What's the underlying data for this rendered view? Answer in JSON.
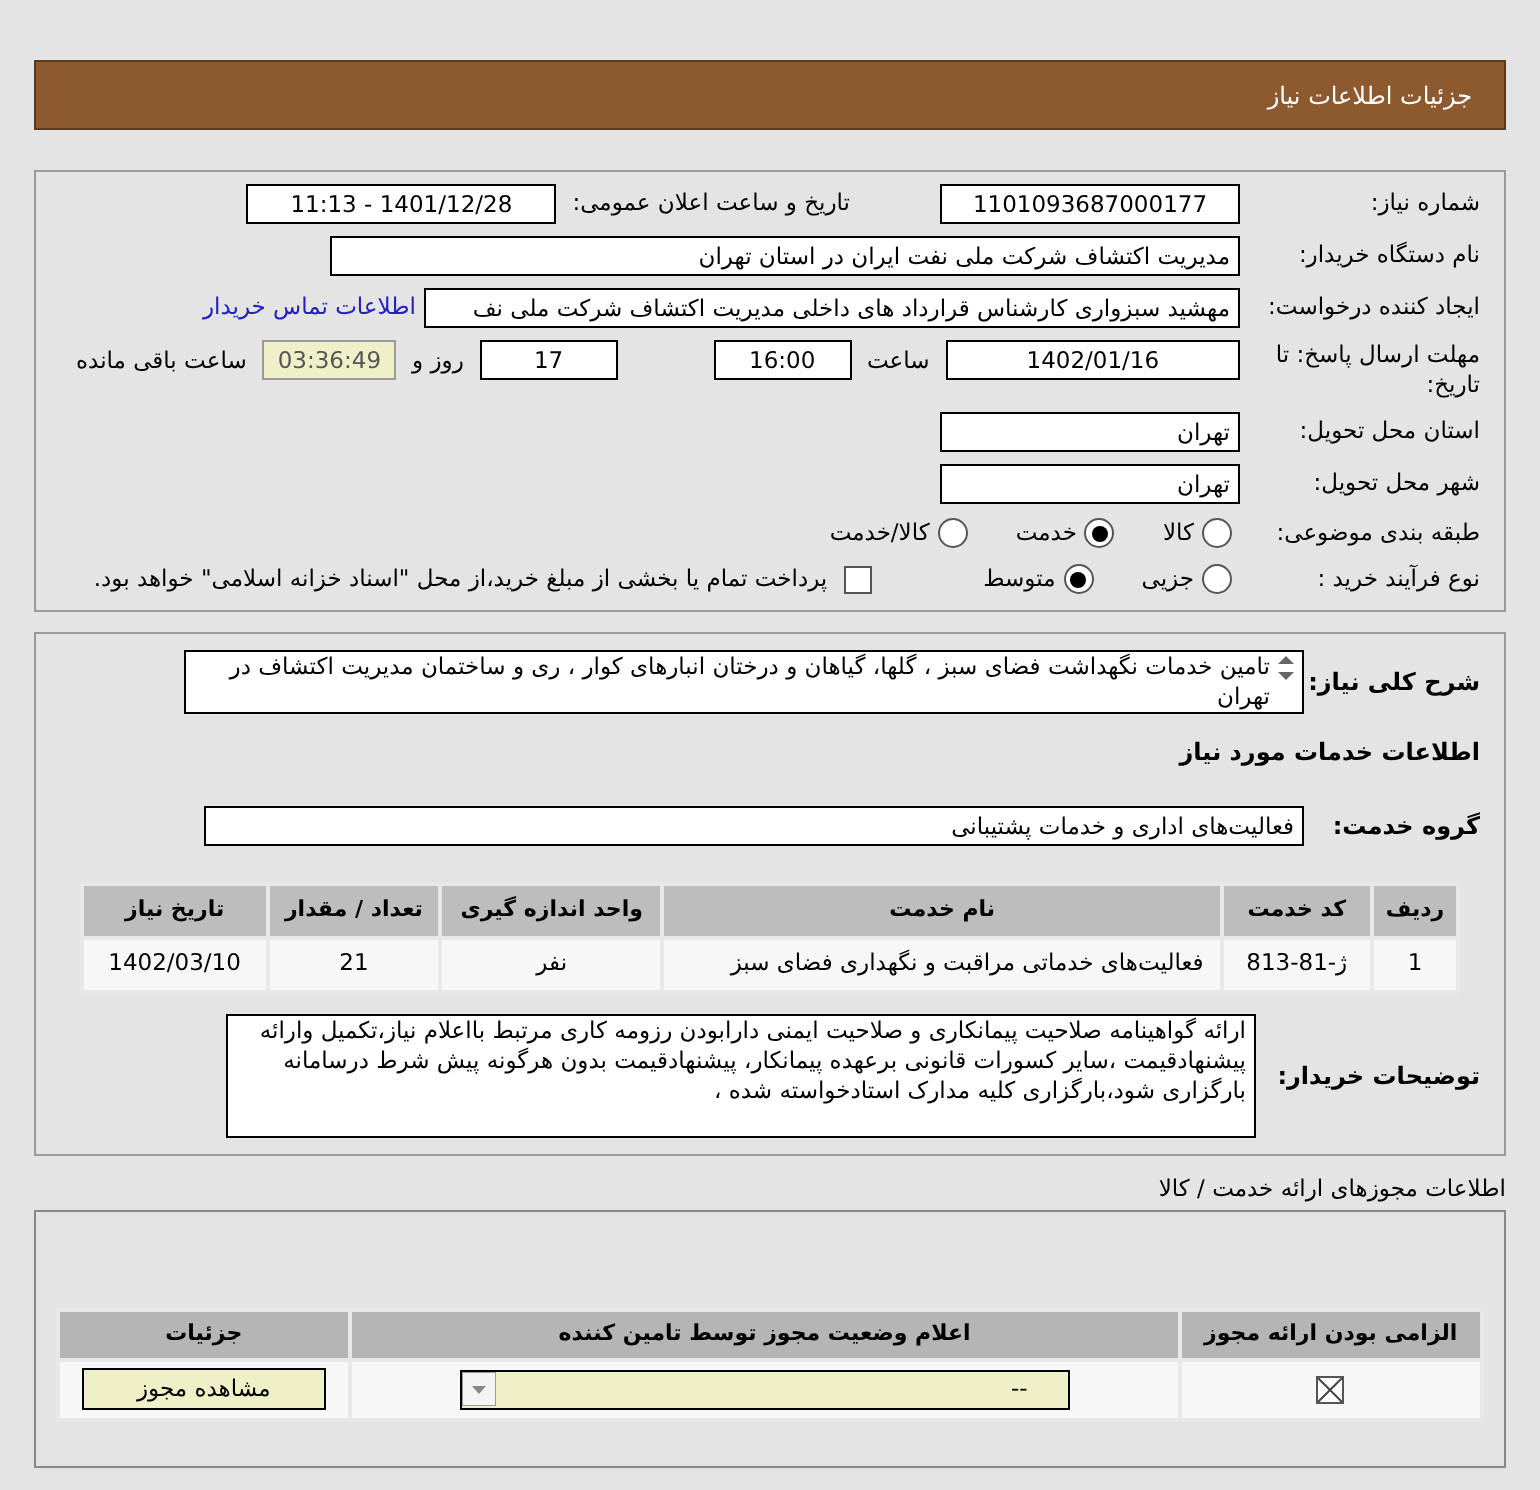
{
  "header": {
    "title": "جزئیات اطلاعات نیاز"
  },
  "info": {
    "need_number": {
      "label": "شماره نیاز:",
      "value": "1101093687000177"
    },
    "announce": {
      "label": "تاریخ و ساعت اعلان عمومی:",
      "value": "1401/12/28 - 11:13"
    },
    "buyer": {
      "label": "نام دستگاه خریدار:",
      "value": "مدیریت اکتشاف شرکت ملی نفت ایران در استان تهران"
    },
    "creator": {
      "label": "ایجاد کننده درخواست:",
      "value": "مهشید سبزواری کارشناس قرارداد های داخلی مدیریت اکتشاف شرکت ملی نف",
      "link": "اطلاعات تماس خریدار"
    },
    "deadline": {
      "label": "مهلت ارسال پاسخ: تا تاریخ:",
      "date": "1402/01/16",
      "time_label": "ساعت",
      "time": "16:00",
      "days": "17",
      "days_label": "روز و",
      "remaining": "03:36:49",
      "remaining_label": "ساعت باقی مانده"
    },
    "province": {
      "label": "استان محل تحویل:",
      "value": "تهران"
    },
    "city": {
      "label": "شهر محل تحویل:",
      "value": "تهران"
    },
    "category": {
      "label": "طبقه بندی موضوعی:",
      "options": [
        {
          "label": "کالا",
          "selected": false
        },
        {
          "label": "خدمت",
          "selected": true
        },
        {
          "label": "کالا/خدمت",
          "selected": false
        }
      ]
    },
    "process": {
      "label": "نوع فرآیند خرید :",
      "options": [
        {
          "label": "جزیی",
          "selected": false
        },
        {
          "label": "متوسط",
          "selected": true
        }
      ],
      "payment": {
        "label": "پرداخت تمام یا بخشی از مبلغ خرید،از محل \"اسناد خزانه اسلامی\" خواهد بود.",
        "checked": false
      }
    }
  },
  "details": {
    "summary": {
      "label": "شرح کلی نیاز:",
      "value": "تامین خدمات نگهداشت فضای سبز ، گلها، گیاهان و درختان انبارهای کوار ، ری و ساختمان مدیریت اکتشاف در تهران"
    },
    "services_title": "اطلاعات خدمات مورد نیاز",
    "group": {
      "label": "گروه خدمت:",
      "value": "فعالیت‌های اداری و خدمات پشتیبانی"
    },
    "table": {
      "columns": [
        "ردیف",
        "کد خدمت",
        "نام خدمت",
        "واحد اندازه گیری",
        "تعداد / مقدار",
        "تاریخ نیاز"
      ],
      "rows": [
        [
          "1",
          "ژ-81-813",
          "فعالیت‌های خدماتی مراقبت و نگهداری فضای سبز",
          "نفر",
          "21",
          "1402/03/10"
        ]
      ]
    },
    "notes": {
      "label": "توضیحات خریدار:",
      "value": "ارائه گواهینامه صلاحیت پیمانکاری و صلاحیت ایمنی دارابودن رزومه کاری مرتبط بااعلام نیاز،تکمیل وارائه پیشنهادقیمت ،سایر کسورات قانونی برعهده پیمانکار، پیشنهادقیمت بدون هرگونه پیش شرط درسامانه بارگزاری شود،بارگزاری کلیه مدارک استادخواسته شده ،"
    }
  },
  "permits": {
    "title": "اطلاعات مجوزهای ارائه خدمت / کالا",
    "columns": [
      "الزامی بودن ارائه مجوز",
      "اعلام وضعیت مجوز توسط تامین کننده",
      "جزئیات"
    ],
    "rows": [
      {
        "required": true,
        "status": "--",
        "button": "مشاهده مجوز"
      }
    ]
  }
}
